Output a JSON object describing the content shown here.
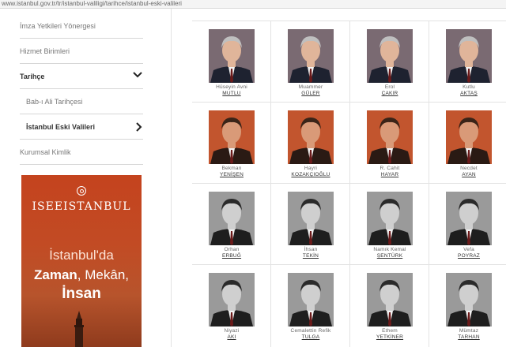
{
  "browser": {
    "url": "www.istanbul.gov.tr/tr/istanbul-valiligi/tarihce/istanbul-eski-valileri"
  },
  "sidebar": {
    "items": [
      {
        "label": "İmza Yetkileri Yönergesi"
      },
      {
        "label": "Hizmet Birimleri"
      },
      {
        "label": "Tarihçe"
      },
      {
        "label": "Bab-ı Ali Tarihçesi"
      },
      {
        "label": "İstanbul Eski Valileri"
      },
      {
        "label": "Kurumsal Kimlik"
      }
    ]
  },
  "promo": {
    "brand": "ISEEISTANBUL",
    "line1": "İstanbul'da",
    "line2_a": "Zaman",
    "line2_b": ", Mekân,",
    "line3": "İnsan"
  },
  "governors": [
    {
      "first": "Hüseyin Avni",
      "last": "MUTLU",
      "style": "color"
    },
    {
      "first": "Muammer",
      "last": "GÜLER",
      "style": "color"
    },
    {
      "first": "Erol",
      "last": "ÇAKIR",
      "style": "color"
    },
    {
      "first": "Kutlu",
      "last": "AKTAŞ",
      "style": "color"
    },
    {
      "first": "Bekman",
      "last": "YENİŞEN",
      "style": "sepia"
    },
    {
      "first": "Hayri",
      "last": "KOZAKÇIOĞLU",
      "style": "sepia"
    },
    {
      "first": "R. Cahit",
      "last": "HAYAR",
      "style": "sepia"
    },
    {
      "first": "Necdet",
      "last": "AYAN",
      "style": "sepia"
    },
    {
      "first": "Orhan",
      "last": "ERBUĞ",
      "style": "bw"
    },
    {
      "first": "İhsan",
      "last": "TEKİN",
      "style": "bw"
    },
    {
      "first": "Namık Kemal",
      "last": "ŞENTÜRK",
      "style": "bw"
    },
    {
      "first": "Vefa",
      "last": "POYRAZ",
      "style": "bw"
    },
    {
      "first": "Niyazi",
      "last": "AKI",
      "style": "bw"
    },
    {
      "first": "Cemalettin Refik",
      "last": "TULGA",
      "style": "bw"
    },
    {
      "first": "Ethem",
      "last": "YETKİNER",
      "style": "bw"
    },
    {
      "first": "Mümtaz",
      "last": "TARHAN",
      "style": "bw"
    }
  ],
  "colors": {
    "promo_bg": "#c4431e",
    "separator": "#d6d6d6"
  }
}
